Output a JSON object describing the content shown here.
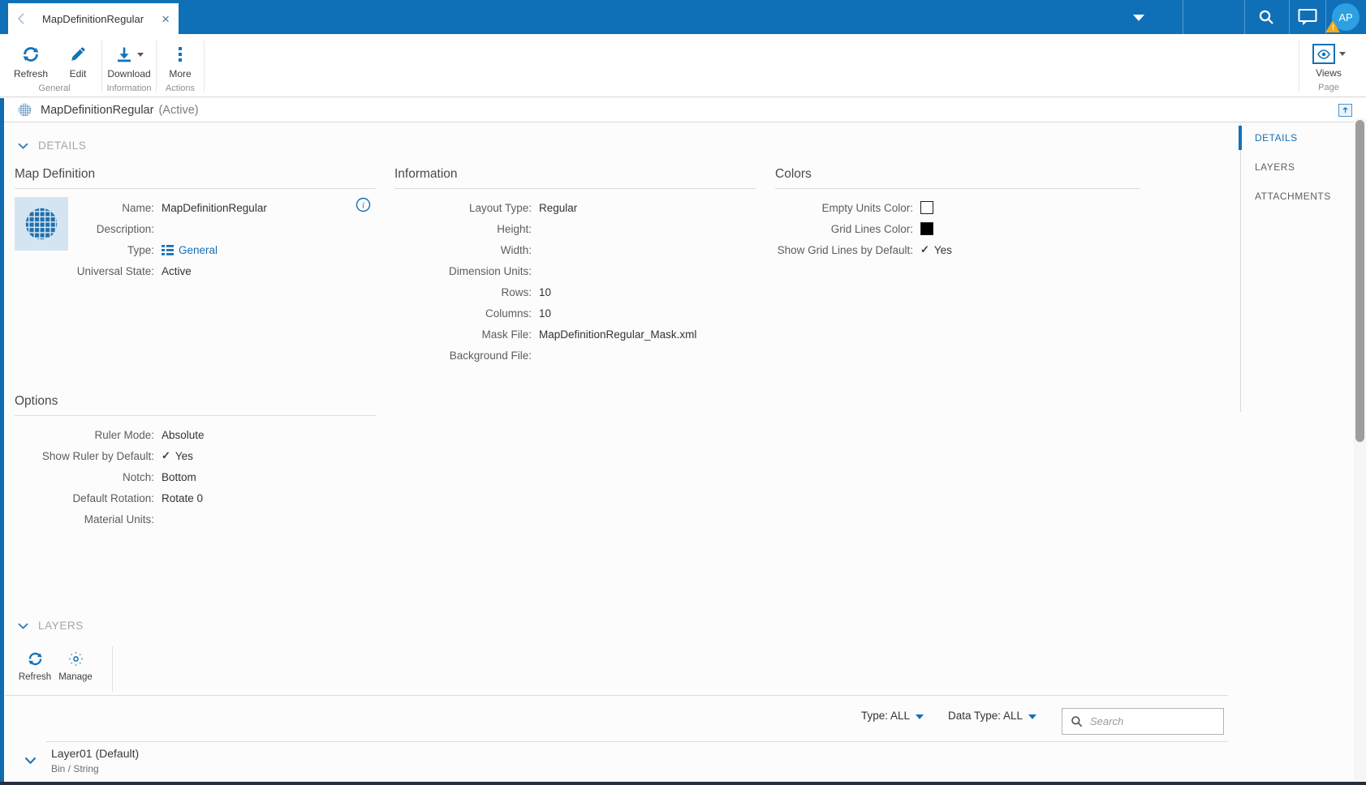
{
  "topbar": {
    "tab_title": "MapDefinitionRegular",
    "avatar_initials": "AP",
    "warning_mark": "!"
  },
  "ribbon": {
    "groups": [
      {
        "label": "General",
        "buttons": [
          {
            "label": "Refresh",
            "icon": "refresh-icon"
          },
          {
            "label": "Edit",
            "icon": "pencil-icon"
          }
        ]
      },
      {
        "label": "Information",
        "buttons": [
          {
            "label": "Download",
            "icon": "download-icon",
            "has_caret": true
          }
        ]
      },
      {
        "label": "Actions",
        "buttons": [
          {
            "label": "More",
            "icon": "more-dots-icon"
          }
        ]
      }
    ],
    "page_group": {
      "label": "Page",
      "button_label": "Views",
      "icon": "eye-icon"
    }
  },
  "titlebar": {
    "title": "MapDefinitionRegular",
    "state": "(Active)"
  },
  "sections": {
    "details": "DETAILS",
    "layers": "LAYERS"
  },
  "map_definition": {
    "heading": "Map Definition",
    "fields": [
      {
        "label": "Name:",
        "value": "MapDefinitionRegular"
      },
      {
        "label": "Description:",
        "value": ""
      },
      {
        "label": "Type:",
        "value": "General"
      },
      {
        "label": "Universal State:",
        "value": "Active"
      }
    ]
  },
  "information": {
    "heading": "Information",
    "fields": [
      {
        "label": "Layout Type:",
        "value": "Regular"
      },
      {
        "label": "Height:",
        "value": ""
      },
      {
        "label": "Width:",
        "value": ""
      },
      {
        "label": "Dimension Units:",
        "value": ""
      },
      {
        "label": "Rows:",
        "value": "10"
      },
      {
        "label": "Columns:",
        "value": "10"
      },
      {
        "label": "Mask File:",
        "value": "MapDefinitionRegular_Mask.xml"
      },
      {
        "label": "Background File:",
        "value": ""
      }
    ]
  },
  "colors_panel": {
    "heading": "Colors",
    "fields": [
      {
        "label": "Empty Units Color:",
        "swatch": "#ffffff"
      },
      {
        "label": "Grid Lines Color:",
        "swatch": "#000000"
      },
      {
        "label": "Show Grid Lines by Default:",
        "value": "Yes"
      }
    ]
  },
  "options": {
    "heading": "Options",
    "fields": [
      {
        "label": "Ruler Mode:",
        "value": "Absolute"
      },
      {
        "label": "Show Ruler by Default:",
        "value": "Yes",
        "check": true
      },
      {
        "label": "Notch:",
        "value": "Bottom"
      },
      {
        "label": "Default Rotation:",
        "value": "Rotate 0"
      },
      {
        "label": "Material Units:",
        "value": ""
      }
    ]
  },
  "layers": {
    "toolbar": [
      {
        "label": "Refresh",
        "icon": "refresh-icon"
      },
      {
        "label": "Manage",
        "icon": "gear-icon"
      }
    ],
    "filters": {
      "type_label": "Type: ALL",
      "data_type_label": "Data Type: ALL",
      "search_placeholder": "Search"
    },
    "layer": {
      "name": "Layer01 (Default)",
      "subtitle": "Bin / String"
    }
  },
  "right_nav": {
    "items": [
      {
        "label": "DETAILS",
        "active": true
      },
      {
        "label": "LAYERS",
        "active": false
      },
      {
        "label": "ATTACHMENTS",
        "active": false
      }
    ]
  },
  "theme": {
    "topbar_blue": "#0f70b8",
    "accent_blue": "#1272b9",
    "avatar_blue": "#2ba0e3",
    "warning_orange": "#f2a71d",
    "bottom_edge_navy": "#242e3e"
  }
}
